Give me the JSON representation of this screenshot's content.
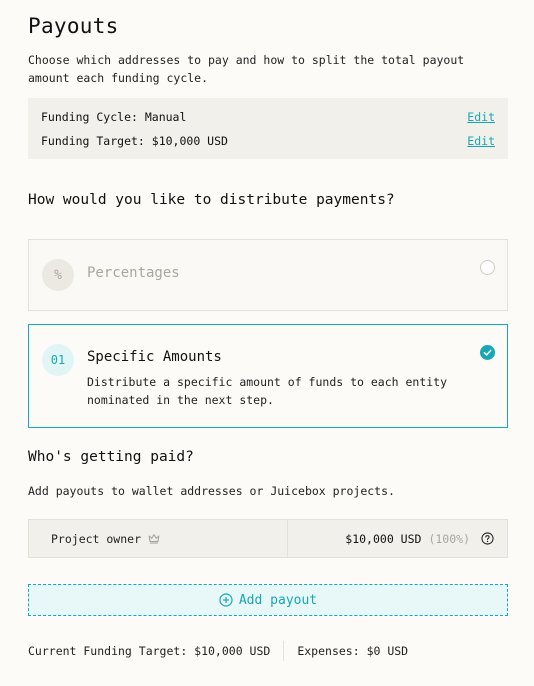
{
  "header": {
    "title": "Payouts",
    "intro": "Choose which addresses to pay and how to split the total payout amount each funding cycle."
  },
  "funding_cycle": {
    "cycle_label": "Funding Cycle: Manual",
    "target_label": "Funding Target: $10,000 USD",
    "edit_label": "Edit"
  },
  "distribution": {
    "question": "How would you like to distribute payments?",
    "options": [
      {
        "icon_text": "%",
        "icon": "percent-icon",
        "title": "Percentages",
        "selected": false
      },
      {
        "icon_text": "01",
        "icon": "number-icon",
        "title": "Specific Amounts",
        "description": "Distribute a specific amount of funds to each entity nominated in the next step.",
        "selected": true
      }
    ]
  },
  "recipients": {
    "title": "Who's getting paid?",
    "description": "Add payouts to wallet addresses or Juicebox projects.",
    "rows": [
      {
        "name": "Project owner",
        "icon": "crown-icon",
        "amount": "$10,000 USD",
        "percent": "(100%)"
      }
    ],
    "add_label": "Add payout"
  },
  "footer": {
    "target": "Current Funding Target: $10,000 USD",
    "expenses": "Expenses: $0 USD"
  },
  "colors": {
    "accent": "#18a7b5",
    "background": "#fcfbf8",
    "panel": "#f2f0ea",
    "muted": "#a9a69d"
  }
}
